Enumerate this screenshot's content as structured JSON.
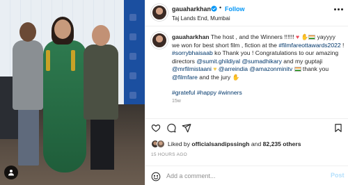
{
  "post": {
    "username": "gauaharkhan",
    "follow_label": "Follow",
    "separator": "•",
    "location": "Taj Lands End, Mumbai",
    "caption": {
      "username": "gauaharkhan",
      "t1": " The host , and the Winners !!!!!! ",
      "t2": " yayyyy we won for best short film , fiction at the ",
      "hashtag_award": "#filmfareottawards2022",
      "t3": " ! ",
      "hashtag_sorry": "#sorrybhaisaab",
      "t4": " ko Thank you ! Congratulations to our amazing directors ",
      "mention_1": "@sumit.ghildiyal",
      "t5": " ",
      "mention_2": "@sumadhikary",
      "t6": " and my guptaji ",
      "mention_3": "@mrfilmistaani",
      "t7": " ",
      "mention_4": "@arreindia",
      "t8": " ",
      "mention_5": "@amazonminitv",
      "t9": " thank you ",
      "mention_6": "@filmfare",
      "t10": " and the jury "
    },
    "hashtags": "#grateful #happy #winners",
    "comment_time": "15w",
    "likes": {
      "prefix": "Liked by ",
      "user": "officialsandipssingh",
      "middle": " and ",
      "count": "82,235 others"
    },
    "timestamp": "15 HOURS AGO",
    "comment": {
      "placeholder": "Add a comment...",
      "post_label": "Post"
    }
  },
  "colors": {
    "link": "#00376b",
    "follow": "#0095f6",
    "heart": "#ed4956",
    "muted": "#8e8e8e",
    "post_disabled": "#b2dffc"
  },
  "icons": {
    "header": [
      "verified-icon",
      "more-options-icon"
    ],
    "actions": [
      "like-icon",
      "comment-icon",
      "share-icon",
      "save-icon"
    ],
    "photo": [
      "tagged-users-icon"
    ],
    "comment_bar": [
      "emoji-icon"
    ]
  }
}
